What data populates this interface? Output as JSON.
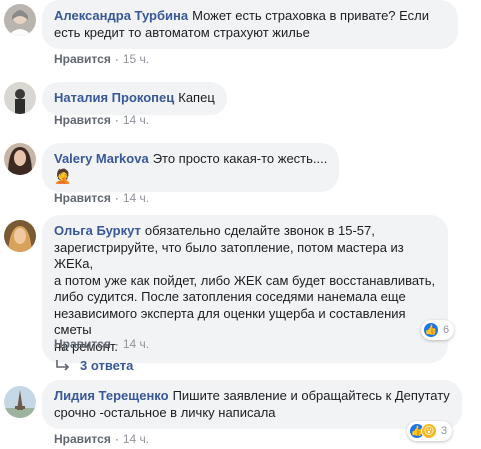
{
  "comments": [
    {
      "author": "Александра Турбина",
      "text_lines": [
        "Может есть страховка в привате? Если",
        "есть кредит то автоматом страхуют жилье"
      ],
      "like_label": "Нравится",
      "time": "15 ч."
    },
    {
      "author": "Наталия Прокопец",
      "text_lines": [
        "Капец"
      ],
      "like_label": "Нравится",
      "time": "14 ч."
    },
    {
      "author": "Valery Markova",
      "text_lines": [
        "Это просто какая-то жесть....",
        "🤦"
      ],
      "like_label": "Нравится",
      "time": "14 ч."
    },
    {
      "author": "Ольга Буркут",
      "text_lines": [
        "обязательно сделайте звонок в 15-57,",
        "зарегистрируйте, что было затопление, потом мастера из ЖЕКа,",
        "а потом уже как пойдет, либо ЖЕК сам будет восстанавливать,",
        "либо судится. После затопления соседями нанемала еще",
        "независимого эксперта для оценки ущерба и составления сметы",
        "на ремонт."
      ],
      "like_label": "Нравится",
      "time": "14 ч.",
      "reactions": {
        "icons": [
          "like-icon"
        ],
        "count": "6"
      },
      "replies_label": "3 ответа"
    },
    {
      "author": "Лидия Терещенко",
      "text_lines": [
        "Пишите заявление и обращайтесь к Депутату",
        "срочно -остальное в личку написала"
      ],
      "like_label": "Нравится",
      "time": "14 ч.",
      "reactions": {
        "icons": [
          "like-icon",
          "wow-icon"
        ],
        "count": "3"
      }
    }
  ],
  "colors": {
    "author": "#385898",
    "bubble_bg": "#f2f3f5",
    "meta": "#606770",
    "like_blue": "#1877f2",
    "wow_yellow": "#f7b928"
  }
}
